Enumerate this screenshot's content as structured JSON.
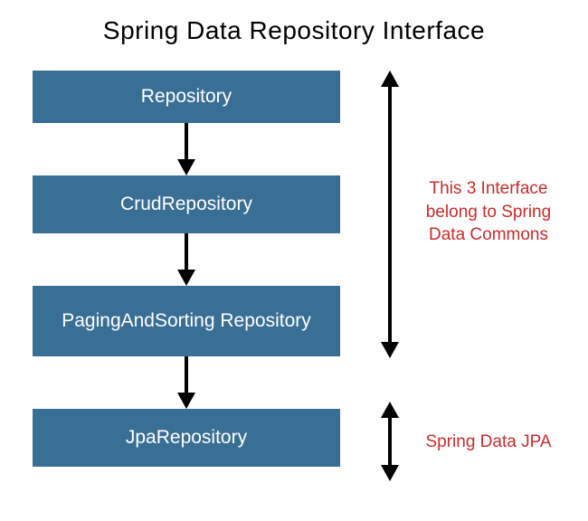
{
  "title": "Spring Data Repository Interface",
  "boxes": [
    {
      "label": "Repository"
    },
    {
      "label": "CrudRepository"
    },
    {
      "label": "PagingAndSorting Repository"
    },
    {
      "label": "JpaRepository"
    }
  ],
  "annotations": {
    "commons": "This 3 Interface belong to Spring Data Commons",
    "jpa": "Spring Data JPA"
  },
  "colors": {
    "box_fill": "#3a6f95",
    "box_text": "#ffffff",
    "annotation_text": "#cc2b2b",
    "title_text": "#000000",
    "arrow": "#000000"
  }
}
